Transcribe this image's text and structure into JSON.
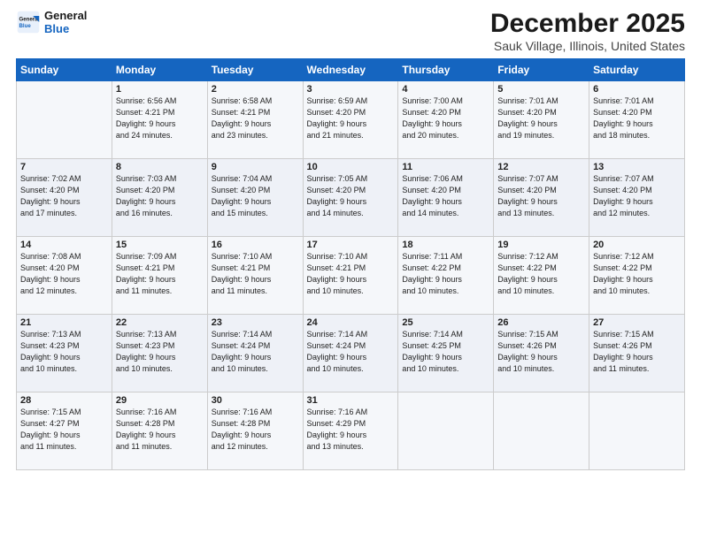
{
  "logo": {
    "line1": "General",
    "line2": "Blue"
  },
  "title": "December 2025",
  "subtitle": "Sauk Village, Illinois, United States",
  "days_of_week": [
    "Sunday",
    "Monday",
    "Tuesday",
    "Wednesday",
    "Thursday",
    "Friday",
    "Saturday"
  ],
  "weeks": [
    [
      {
        "day": "",
        "info": ""
      },
      {
        "day": "1",
        "info": "Sunrise: 6:56 AM\nSunset: 4:21 PM\nDaylight: 9 hours\nand 24 minutes."
      },
      {
        "day": "2",
        "info": "Sunrise: 6:58 AM\nSunset: 4:21 PM\nDaylight: 9 hours\nand 23 minutes."
      },
      {
        "day": "3",
        "info": "Sunrise: 6:59 AM\nSunset: 4:20 PM\nDaylight: 9 hours\nand 21 minutes."
      },
      {
        "day": "4",
        "info": "Sunrise: 7:00 AM\nSunset: 4:20 PM\nDaylight: 9 hours\nand 20 minutes."
      },
      {
        "day": "5",
        "info": "Sunrise: 7:01 AM\nSunset: 4:20 PM\nDaylight: 9 hours\nand 19 minutes."
      },
      {
        "day": "6",
        "info": "Sunrise: 7:01 AM\nSunset: 4:20 PM\nDaylight: 9 hours\nand 18 minutes."
      }
    ],
    [
      {
        "day": "7",
        "info": "Sunrise: 7:02 AM\nSunset: 4:20 PM\nDaylight: 9 hours\nand 17 minutes."
      },
      {
        "day": "8",
        "info": "Sunrise: 7:03 AM\nSunset: 4:20 PM\nDaylight: 9 hours\nand 16 minutes."
      },
      {
        "day": "9",
        "info": "Sunrise: 7:04 AM\nSunset: 4:20 PM\nDaylight: 9 hours\nand 15 minutes."
      },
      {
        "day": "10",
        "info": "Sunrise: 7:05 AM\nSunset: 4:20 PM\nDaylight: 9 hours\nand 14 minutes."
      },
      {
        "day": "11",
        "info": "Sunrise: 7:06 AM\nSunset: 4:20 PM\nDaylight: 9 hours\nand 14 minutes."
      },
      {
        "day": "12",
        "info": "Sunrise: 7:07 AM\nSunset: 4:20 PM\nDaylight: 9 hours\nand 13 minutes."
      },
      {
        "day": "13",
        "info": "Sunrise: 7:07 AM\nSunset: 4:20 PM\nDaylight: 9 hours\nand 12 minutes."
      }
    ],
    [
      {
        "day": "14",
        "info": "Sunrise: 7:08 AM\nSunset: 4:20 PM\nDaylight: 9 hours\nand 12 minutes."
      },
      {
        "day": "15",
        "info": "Sunrise: 7:09 AM\nSunset: 4:21 PM\nDaylight: 9 hours\nand 11 minutes."
      },
      {
        "day": "16",
        "info": "Sunrise: 7:10 AM\nSunset: 4:21 PM\nDaylight: 9 hours\nand 11 minutes."
      },
      {
        "day": "17",
        "info": "Sunrise: 7:10 AM\nSunset: 4:21 PM\nDaylight: 9 hours\nand 10 minutes."
      },
      {
        "day": "18",
        "info": "Sunrise: 7:11 AM\nSunset: 4:22 PM\nDaylight: 9 hours\nand 10 minutes."
      },
      {
        "day": "19",
        "info": "Sunrise: 7:12 AM\nSunset: 4:22 PM\nDaylight: 9 hours\nand 10 minutes."
      },
      {
        "day": "20",
        "info": "Sunrise: 7:12 AM\nSunset: 4:22 PM\nDaylight: 9 hours\nand 10 minutes."
      }
    ],
    [
      {
        "day": "21",
        "info": "Sunrise: 7:13 AM\nSunset: 4:23 PM\nDaylight: 9 hours\nand 10 minutes."
      },
      {
        "day": "22",
        "info": "Sunrise: 7:13 AM\nSunset: 4:23 PM\nDaylight: 9 hours\nand 10 minutes."
      },
      {
        "day": "23",
        "info": "Sunrise: 7:14 AM\nSunset: 4:24 PM\nDaylight: 9 hours\nand 10 minutes."
      },
      {
        "day": "24",
        "info": "Sunrise: 7:14 AM\nSunset: 4:24 PM\nDaylight: 9 hours\nand 10 minutes."
      },
      {
        "day": "25",
        "info": "Sunrise: 7:14 AM\nSunset: 4:25 PM\nDaylight: 9 hours\nand 10 minutes."
      },
      {
        "day": "26",
        "info": "Sunrise: 7:15 AM\nSunset: 4:26 PM\nDaylight: 9 hours\nand 10 minutes."
      },
      {
        "day": "27",
        "info": "Sunrise: 7:15 AM\nSunset: 4:26 PM\nDaylight: 9 hours\nand 11 minutes."
      }
    ],
    [
      {
        "day": "28",
        "info": "Sunrise: 7:15 AM\nSunset: 4:27 PM\nDaylight: 9 hours\nand 11 minutes."
      },
      {
        "day": "29",
        "info": "Sunrise: 7:16 AM\nSunset: 4:28 PM\nDaylight: 9 hours\nand 11 minutes."
      },
      {
        "day": "30",
        "info": "Sunrise: 7:16 AM\nSunset: 4:28 PM\nDaylight: 9 hours\nand 12 minutes."
      },
      {
        "day": "31",
        "info": "Sunrise: 7:16 AM\nSunset: 4:29 PM\nDaylight: 9 hours\nand 13 minutes."
      },
      {
        "day": "",
        "info": ""
      },
      {
        "day": "",
        "info": ""
      },
      {
        "day": "",
        "info": ""
      }
    ]
  ]
}
